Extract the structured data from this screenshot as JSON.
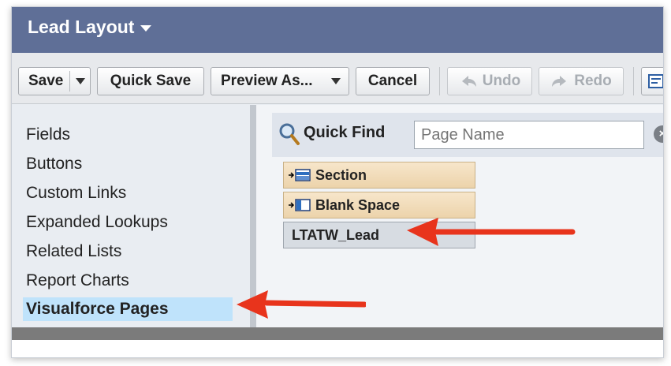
{
  "header": {
    "title": "Lead Layout"
  },
  "toolbar": {
    "save_label": "Save",
    "quick_save_label": "Quick Save",
    "preview_label": "Preview As...",
    "cancel_label": "Cancel",
    "undo_label": "Undo",
    "redo_label": "Redo"
  },
  "sidebar": {
    "items": [
      {
        "label": "Fields"
      },
      {
        "label": "Buttons"
      },
      {
        "label": "Custom Links"
      },
      {
        "label": "Expanded Lookups"
      },
      {
        "label": "Related Lists"
      },
      {
        "label": "Report Charts"
      },
      {
        "label": "Visualforce Pages",
        "selected": true
      }
    ]
  },
  "quick_find": {
    "label": "Quick Find",
    "placeholder": "Page Name"
  },
  "palette": [
    {
      "label": "Section",
      "icon": "section-icon"
    },
    {
      "label": "Blank Space",
      "icon": "blank-space-icon"
    },
    {
      "label": "LTATW_Lead",
      "icon": ""
    }
  ],
  "colors": {
    "header": "#5f6f97",
    "selected": "#bfe3fb",
    "palette_tan": "#ecd3ab",
    "annotation_arrow": "#e8341c"
  }
}
